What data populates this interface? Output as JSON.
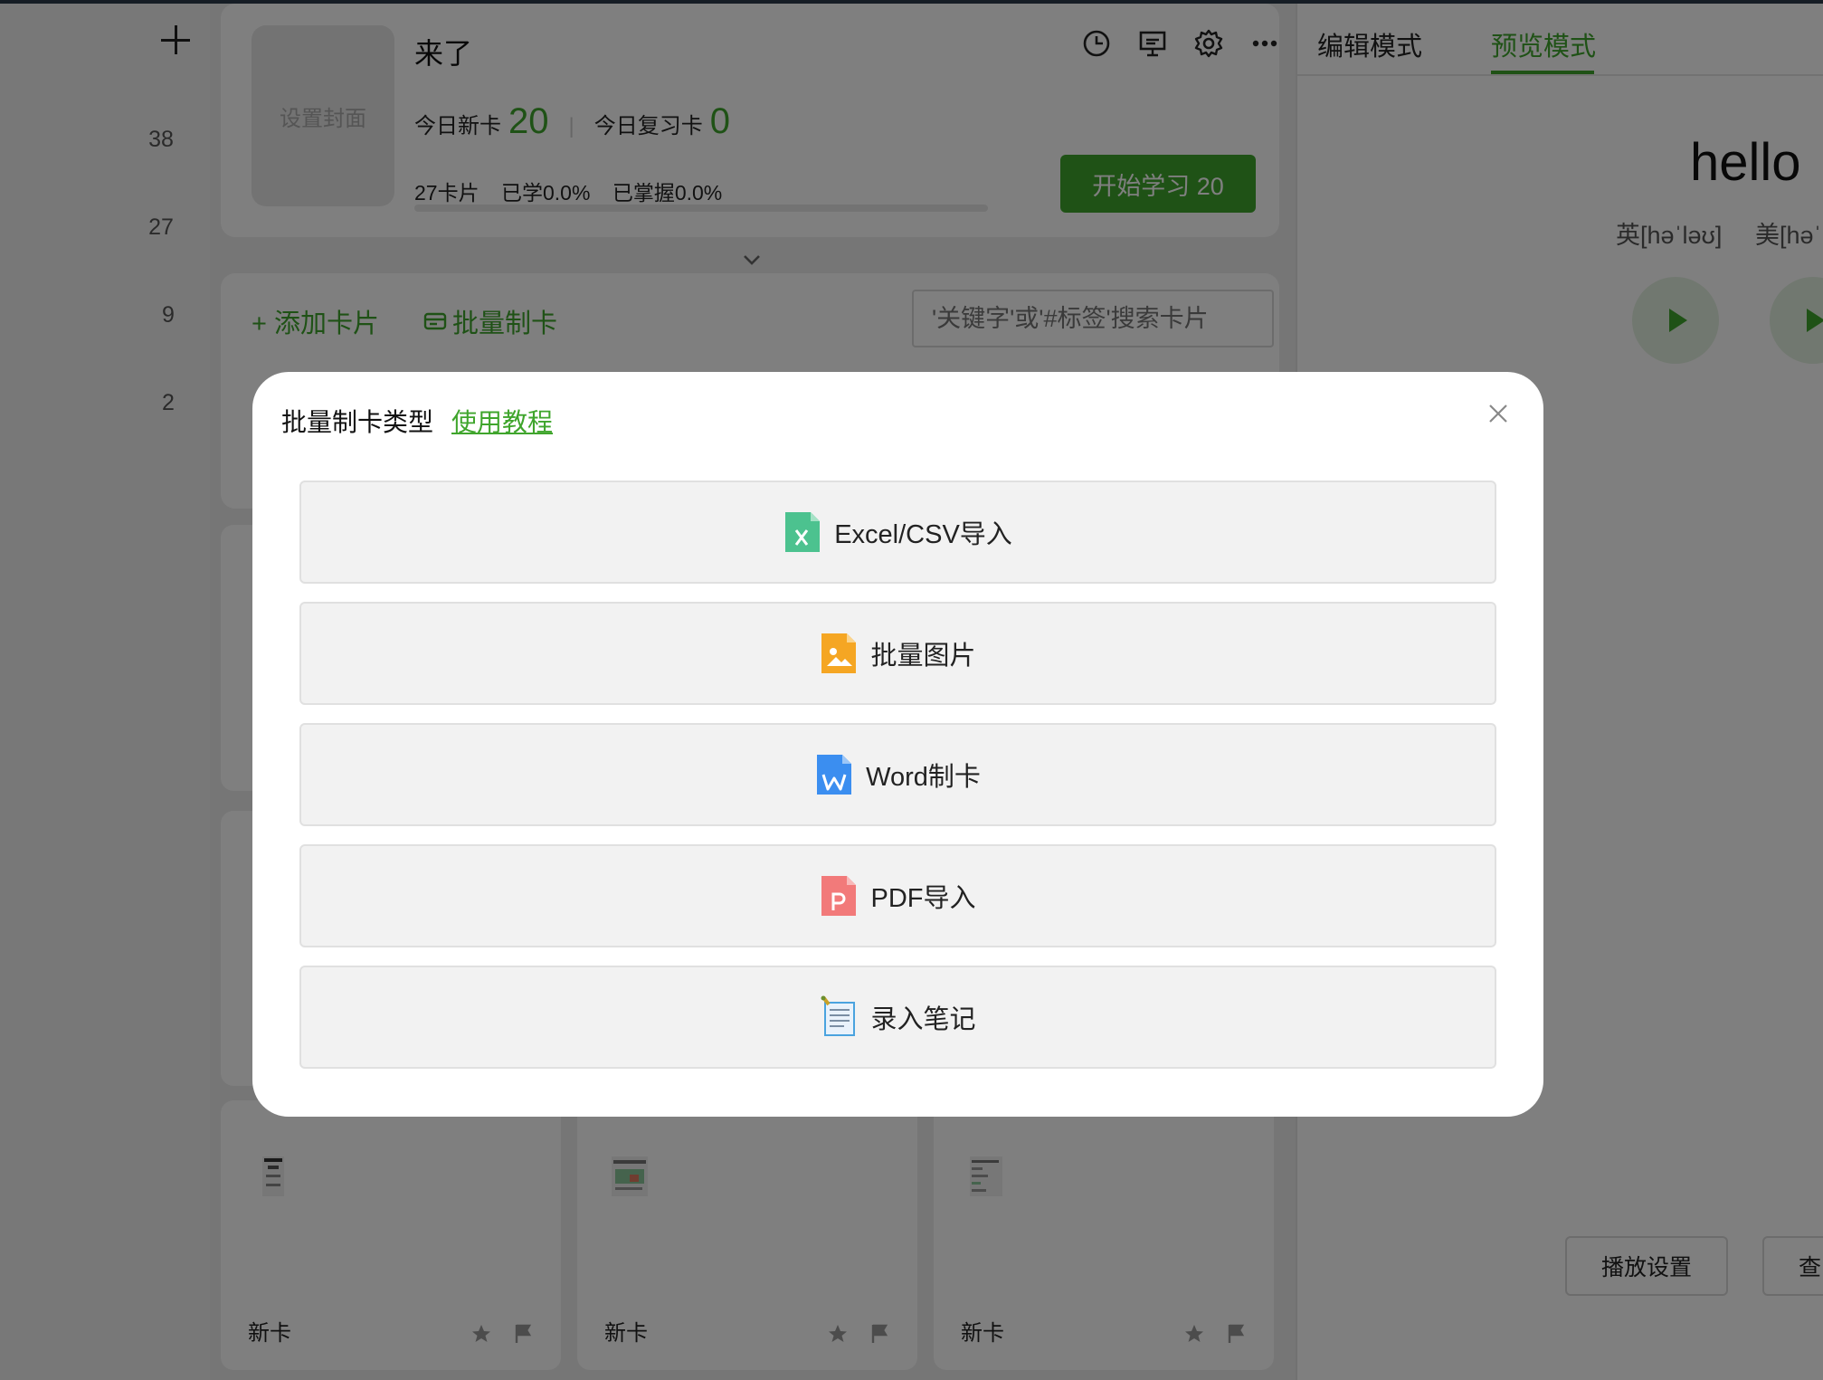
{
  "left_rail": {
    "counts": [
      "38",
      "27",
      "9",
      "2"
    ]
  },
  "deck": {
    "cover_label": "设置封面",
    "title": "来了",
    "new_today_label": "今日新卡",
    "new_today_value": "20",
    "separator": "|",
    "review_today_label": "今日复习卡",
    "review_today_value": "0",
    "card_count": "27卡片",
    "learned": "已学0.0%",
    "mastered": "已掌握0.0%",
    "progress_fraction": 0.0,
    "start_button": "开始学习 20"
  },
  "actions": {
    "add_card": "+ 添加卡片",
    "batch_create": "批量制卡",
    "search_placeholder": "'关键字'或'#标签'搜索卡片"
  },
  "cards": [
    {
      "label": "新卡"
    },
    {
      "label": "新卡"
    },
    {
      "label": "新卡"
    }
  ],
  "preview": {
    "tabs": [
      "编辑模式",
      "预览模式"
    ],
    "active_tab": "预览模式",
    "word": "hello",
    "phonetic_uk": "英[həˈləʊ]",
    "phonetic_us": "美[həˈ",
    "play_settings": "播放设置",
    "view_button": "查"
  },
  "modal": {
    "title": "批量制卡类型",
    "tutorial_link": "使用教程",
    "options": [
      {
        "label": "Excel/CSV导入",
        "icon": "excel-file-icon",
        "color": "#4cc28f"
      },
      {
        "label": "批量图片",
        "icon": "image-file-icon",
        "color": "#f5a623"
      },
      {
        "label": "Word制卡",
        "icon": "word-file-icon",
        "color": "#3b8ef0"
      },
      {
        "label": "PDF导入",
        "icon": "pdf-file-icon",
        "color": "#f27a7a"
      },
      {
        "label": "录入笔记",
        "icon": "notepad-icon",
        "color": "#4aa3df"
      }
    ]
  },
  "colors": {
    "accent": "#3fa52c",
    "overlay": "rgba(0,0,0,0.5)"
  }
}
